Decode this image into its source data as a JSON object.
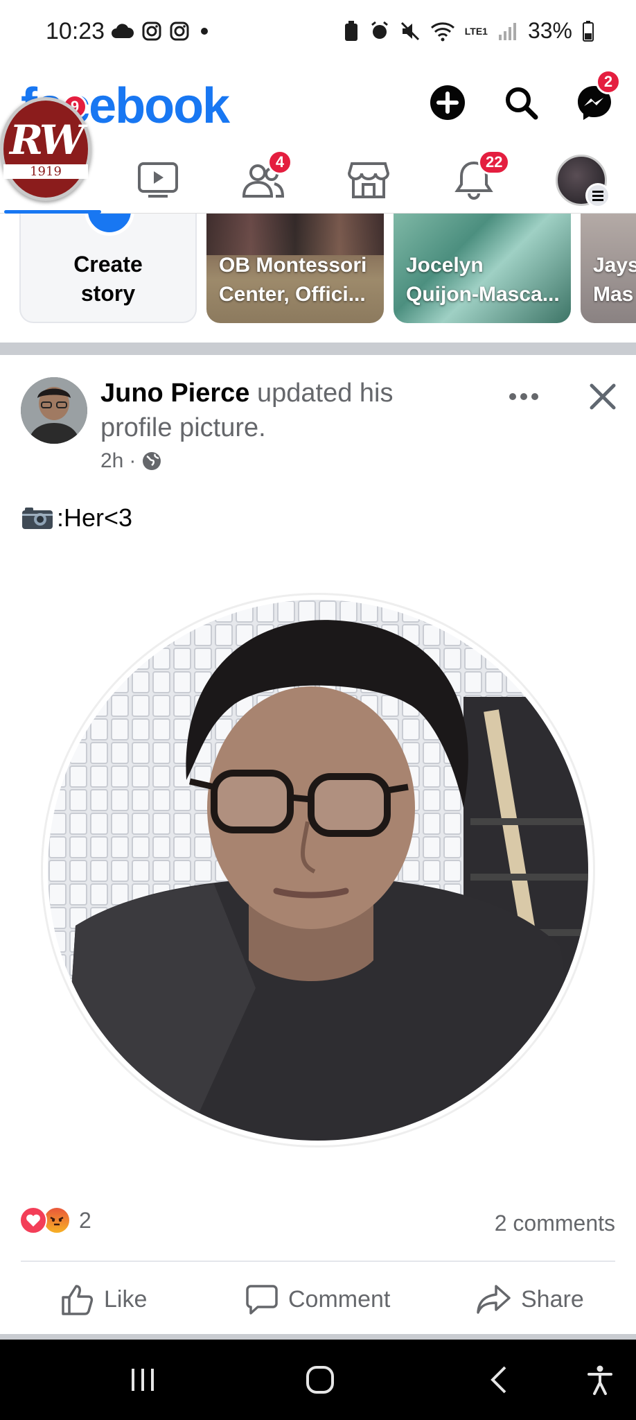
{
  "status_bar": {
    "time": "10:23",
    "battery": "33%",
    "network": "LTE1"
  },
  "header": {
    "logo_text": "facebook",
    "messenger_badge": "2"
  },
  "tabs": {
    "friends_badge": "4",
    "notifications_badge": "22",
    "home_badge": "9"
  },
  "overlay_logo": {
    "monogram": "RW",
    "year": "1919"
  },
  "stories": [
    {
      "label": "Create story",
      "line1": "Create",
      "line2": "story"
    },
    {
      "line1": "OB Montessori",
      "line2": "Center, Offici..."
    },
    {
      "line1": "Jocelyn",
      "line2": "Quijon-Masca..."
    },
    {
      "line1": "Jays",
      "line2": "Mas"
    }
  ],
  "post": {
    "author": "Juno Pierce",
    "action_text": " updated his profile picture.",
    "time": "2h",
    "separator": "·",
    "caption": ":Her<3",
    "reactions_count": "2",
    "comments": "2 comments",
    "like_label": "Like",
    "comment_label": "Comment",
    "share_label": "Share"
  },
  "colors": {
    "brand": "#1877f2",
    "badge": "#e41e3f",
    "secondary_text": "#65676b"
  }
}
